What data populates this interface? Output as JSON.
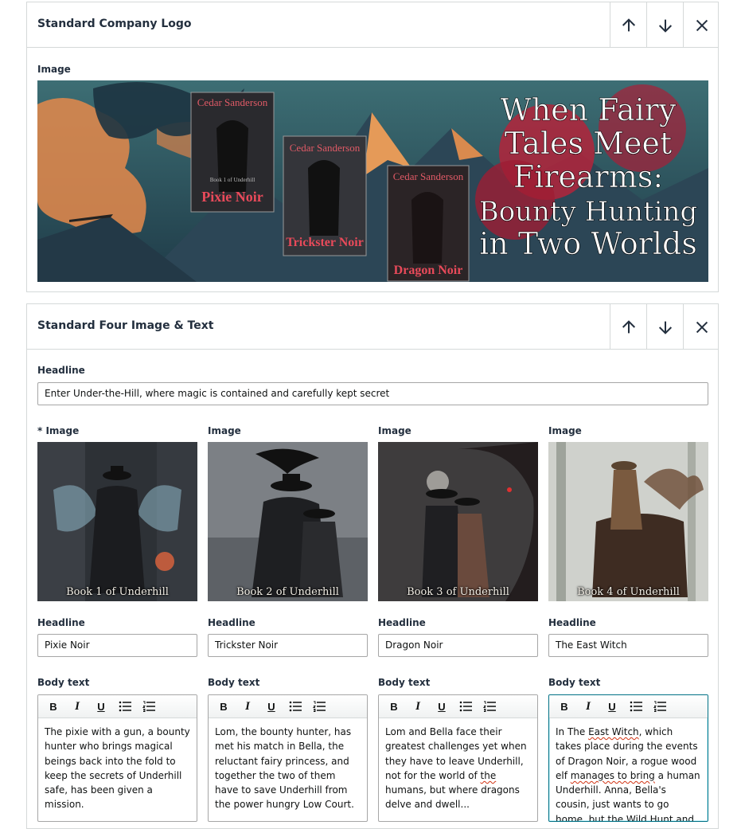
{
  "logo_module": {
    "title": "Standard Company Logo",
    "image_label": "Image",
    "banner": {
      "book_author": "Cedar Sanderson",
      "book_titles": [
        "Pixie Noir",
        "Trickster Noir",
        "Dragon Noir"
      ],
      "series_line": "Book 1 of Underhill",
      "tagline": [
        "When Fairy",
        "Tales Meet",
        "Firearms:",
        "Bounty Hunting",
        "in Two Worlds"
      ]
    }
  },
  "four_image_module": {
    "title": "Standard Four Image & Text",
    "headline_label": "Headline",
    "headline_value": "Enter Under-the-Hill, where magic is contained and carefully kept secret",
    "columns": [
      {
        "image_label": "* Image",
        "caption": "Book 1 of Underhill",
        "headline_label": "Headline",
        "headline_value": "Pixie Noir",
        "body_label": "Body text",
        "body_text": "The pixie with a gun, a bounty hunter who brings magical beings back into the fold to keep the secrets of Underhill safe, has been given a mission."
      },
      {
        "image_label": "Image",
        "caption": "Book 2 of Underhill",
        "headline_label": "Headline",
        "headline_value": "Trickster Noir",
        "body_label": "Body text",
        "body_text": "Lom, the bounty hunter, has met his match in Bella, the reluctant fairy princess, and together the two of them have to save Underhill from the power hungry Low Court."
      },
      {
        "image_label": "Image",
        "caption": "Book 3 of Underhill",
        "headline_label": "Headline",
        "headline_value": "Dragon Noir",
        "body_label": "Body text",
        "body_text_parts": [
          "Lom and Bella face their greatest challenges yet when they have to leave Underhill, not for the world of ",
          "the",
          " humans, but where dragons delve and dwell..."
        ]
      },
      {
        "image_label": "Image",
        "caption": "Book 4 of Underhill",
        "headline_label": "Headline",
        "headline_value": "The East Witch",
        "body_label": "Body text",
        "body_text_parts": [
          "In The ",
          "East Witch",
          ", which takes place during the events of Dragon Noir, a rogue wood elf ",
          "manages to bring",
          " a human Underhill. Anna, Bella's cousin, just wants to go home, but the Wild Hunt and Baba Yaga and"
        ]
      }
    ]
  },
  "toolbar": {
    "bold": "B",
    "italic": "I",
    "underline": "U",
    "bullets_icon": "bulleted-list-icon",
    "numbers_icon": "numbered-list-icon"
  },
  "colors": {
    "border": "#d5d9d9",
    "focus": "#007185",
    "title_text": "#232f3e"
  }
}
